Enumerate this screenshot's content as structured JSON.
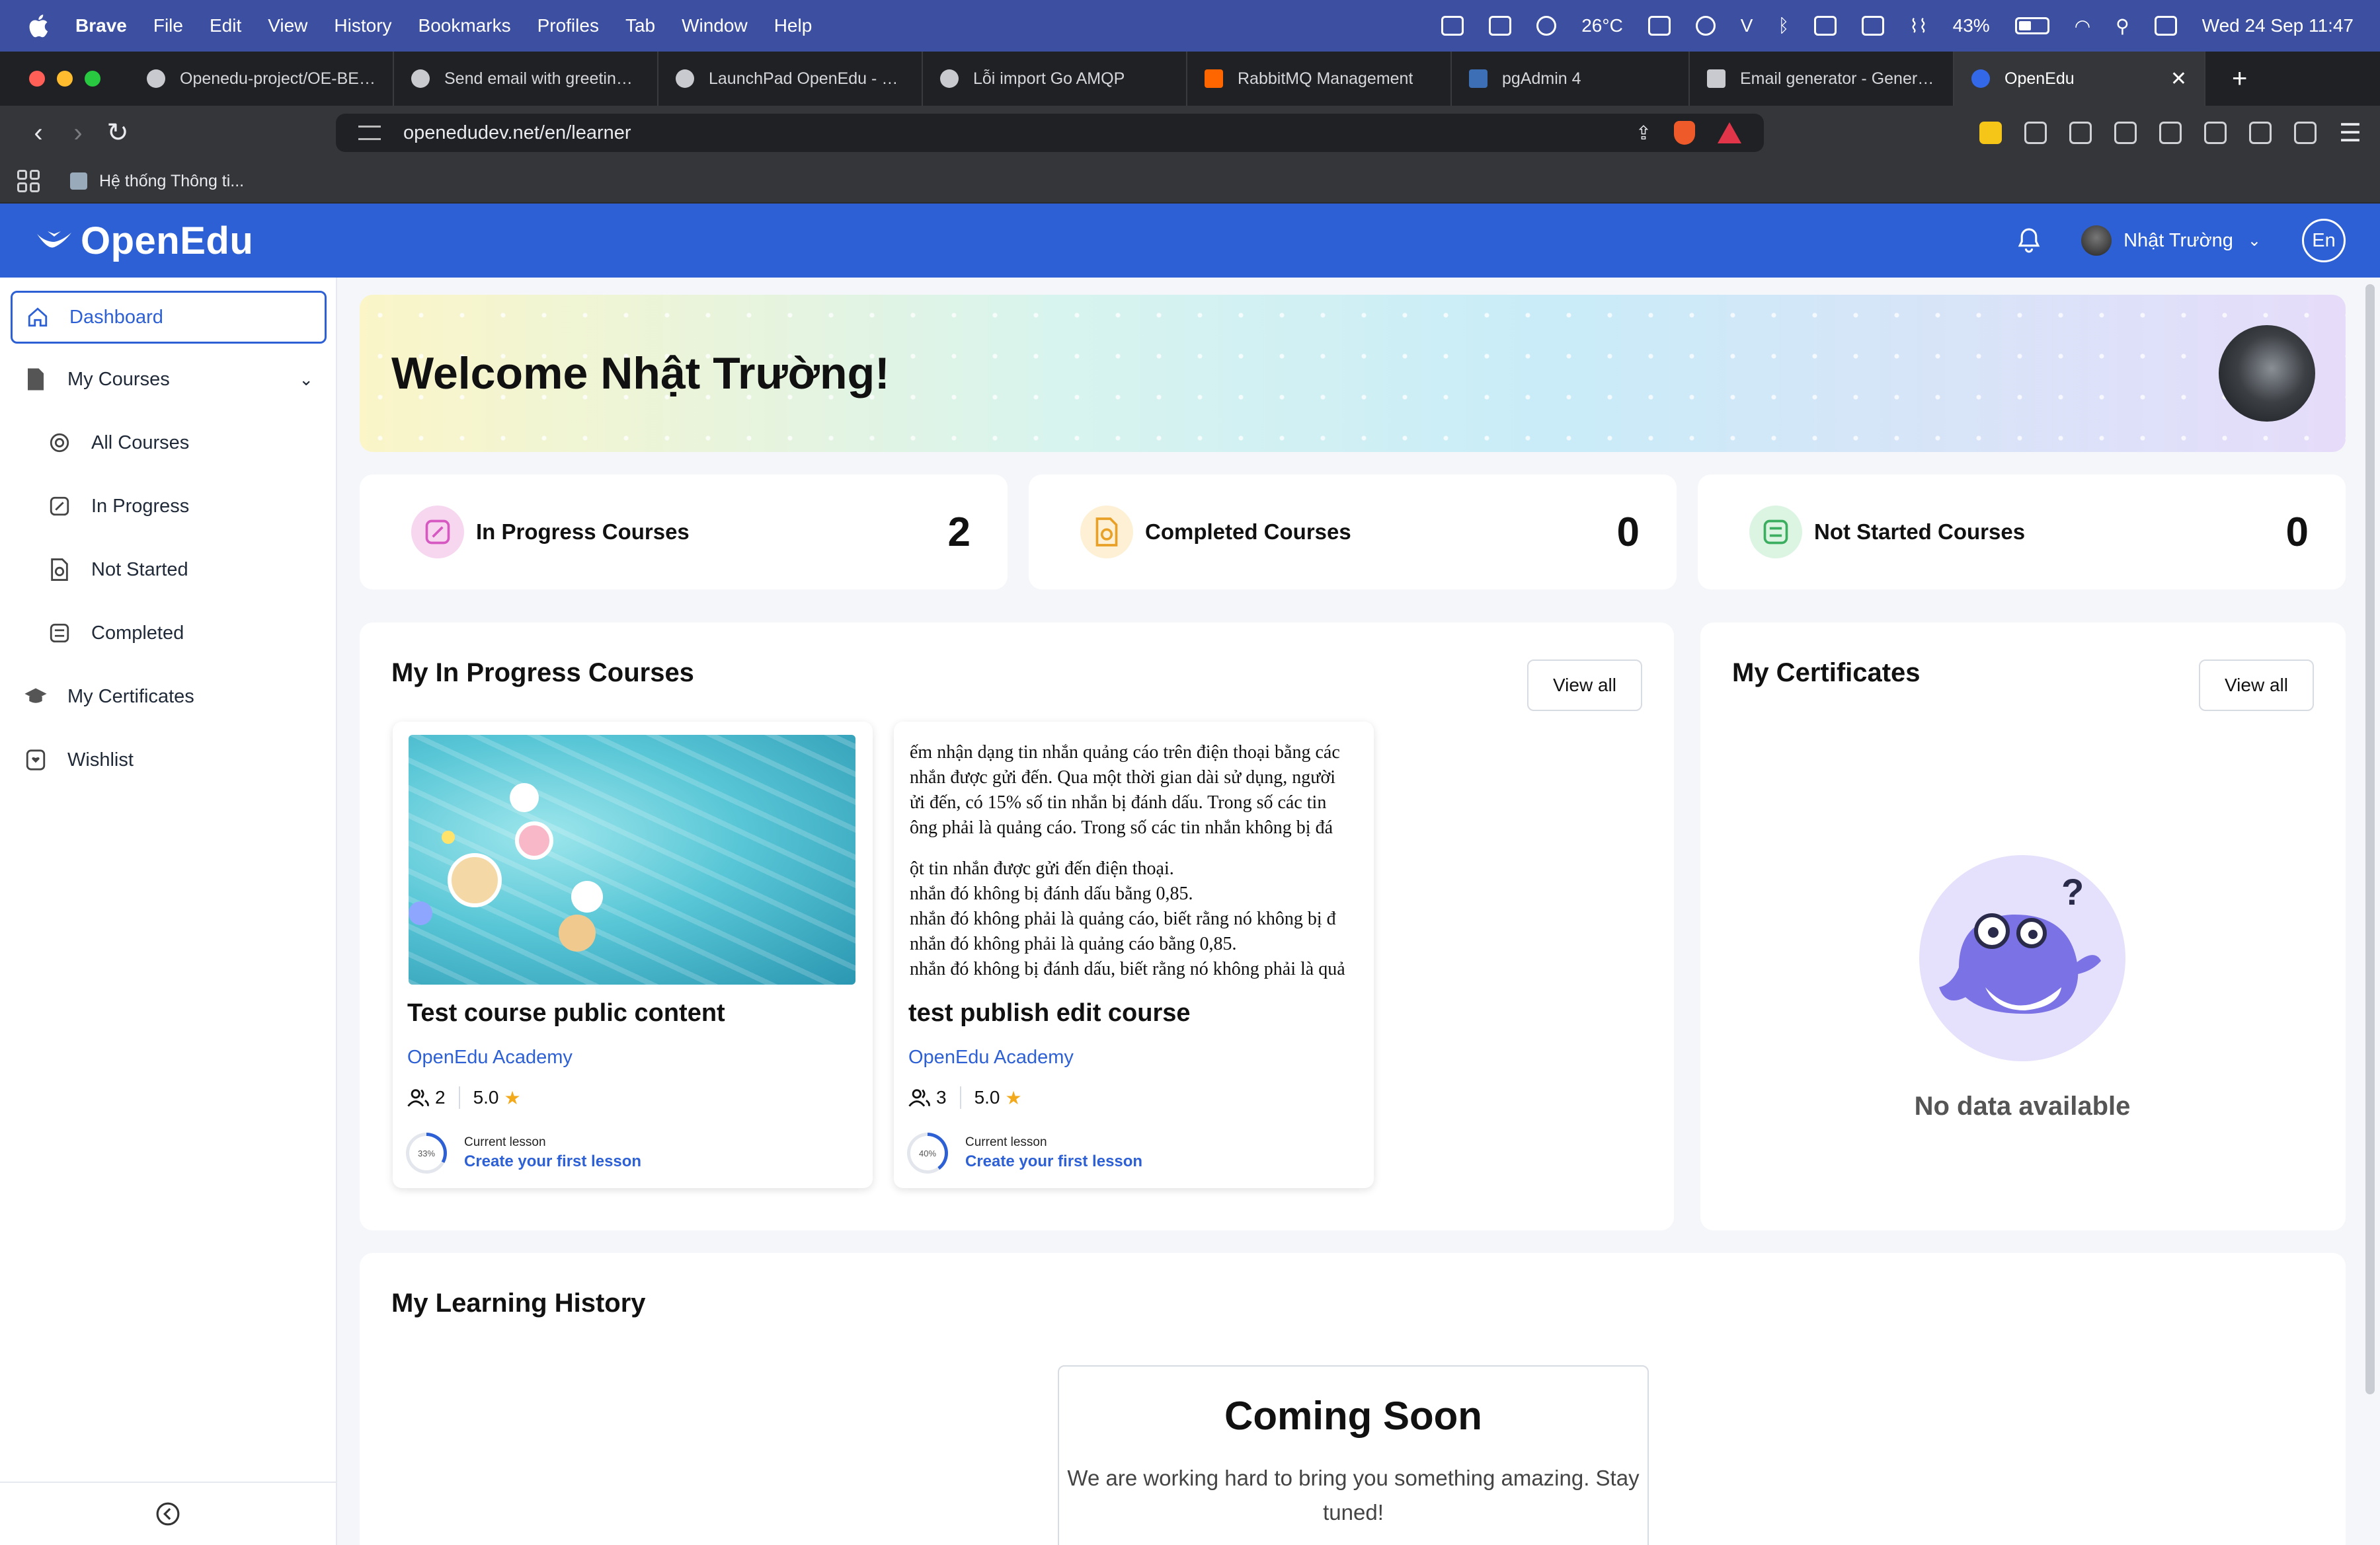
{
  "menubar": {
    "app": "Brave",
    "items": [
      "File",
      "Edit",
      "View",
      "History",
      "Bookmarks",
      "Profiles",
      "Tab",
      "Window",
      "Help"
    ],
    "weather": "26°C",
    "battery": "43%",
    "datetime": "Wed 24 Sep  11:47"
  },
  "tabs": [
    {
      "label": "Openedu-project/OE-BE at"
    },
    {
      "label": "Send email with greeting w"
    },
    {
      "label": "LaunchPad OpenEdu - Dịch"
    },
    {
      "label": "Lỗi import Go AMQP"
    },
    {
      "label": "RabbitMQ Management"
    },
    {
      "label": "pgAdmin 4"
    },
    {
      "label": "Email generator - Generate"
    },
    {
      "label": "OpenEdu"
    }
  ],
  "address": {
    "url": "openedudev.net/en/learner"
  },
  "bookmarks": {
    "item": "Hệ thống Thông ti..."
  },
  "header": {
    "logo": "OpenEdu",
    "user": "Nhật Trường",
    "lang": "En"
  },
  "sidebar": {
    "dashboard": "Dashboard",
    "my_courses": "My Courses",
    "all_courses": "All Courses",
    "in_progress": "In Progress",
    "not_started": "Not Started",
    "completed": "Completed",
    "certificates": "My Certificates",
    "wishlist": "Wishlist"
  },
  "welcome": {
    "text": "Welcome Nhật Trường!"
  },
  "stats": [
    {
      "label": "In Progress Courses",
      "value": "2",
      "color": "#f7d6f0"
    },
    {
      "label": "Completed Courses",
      "value": "0",
      "color": "#fdf0d4"
    },
    {
      "label": "Not Started Courses",
      "value": "0",
      "color": "#dcf5e3"
    }
  ],
  "in_progress_panel": {
    "title": "My In Progress Courses",
    "view_all": "View all",
    "courses": [
      {
        "title": "Test course public content",
        "org": "OpenEdu Academy",
        "learners": "2",
        "rating": "5.0",
        "progress": 33,
        "progress_label": "33%",
        "current_lesson_label": "Current lesson",
        "current_lesson": "Create your first lesson"
      },
      {
        "title": "test publish edit course",
        "org": "OpenEdu Academy",
        "learners": "3",
        "rating": "5.0",
        "progress": 40,
        "progress_label": "40%",
        "current_lesson_label": "Current lesson",
        "current_lesson": "Create your first lesson",
        "thumb_lines": [
          "ếm nhận dạng tin nhắn quảng cáo trên điện thoại bằng các",
          "nhắn được gửi đến. Qua một thời gian dài sử dụng, người",
          "ửi đến, có 15%  số tin nhắn bị đánh dấu. Trong số các tin",
          "ông phải là quảng cáo. Trong số các tin nhắn không bị đá",
          "",
          "ột tin nhắn được gửi đến điện thoại.",
          " nhắn đó không bị đánh dấu bằng  0,85.",
          " nhắn đó không phải là quảng cáo, biết rằng nó không bị đ",
          " nhắn đó không phải là quảng cáo bằng  0,85.",
          " nhắn đó không bị đánh dấu, biết rằng nó không phải là quả"
        ]
      }
    ]
  },
  "certificates_panel": {
    "title": "My Certificates",
    "view_all": "View all",
    "empty": "No data available"
  },
  "history_panel": {
    "title": "My Learning History",
    "soon_title": "Coming Soon",
    "soon_text": "We are working hard to bring you something amazing. Stay tuned!"
  }
}
